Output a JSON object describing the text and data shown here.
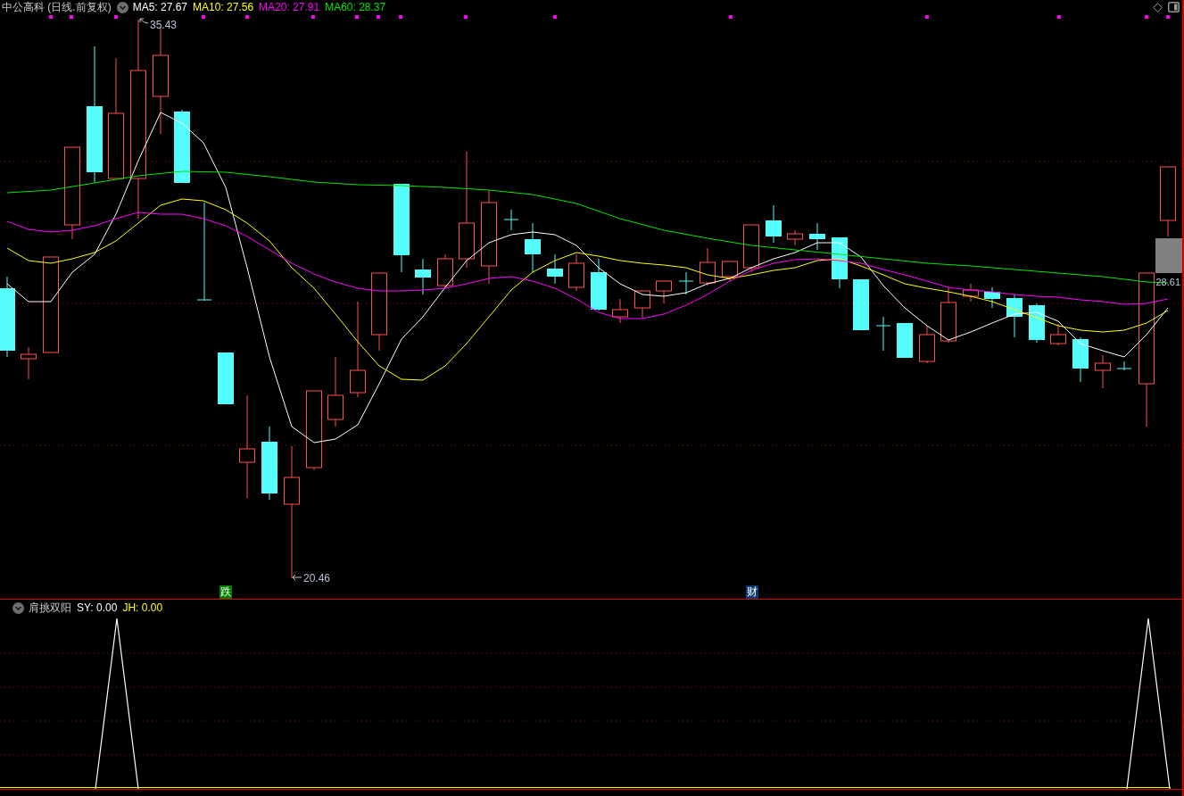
{
  "chart_header": {
    "title": "中公高科 (日线.前复权)",
    "indicators": [
      {
        "label": "MA5: 27.67",
        "color": "#ffffff"
      },
      {
        "label": "MA10: 27.56",
        "color": "#ffff00"
      },
      {
        "label": "MA20: 27.91",
        "color": "#ff00ff"
      },
      {
        "label": "MA60: 28.37",
        "color": "#00e600"
      }
    ]
  },
  "main_chart": {
    "high_label": "35.43",
    "low_label": "20.46",
    "last_price": "28.61",
    "events": [
      {
        "label": "跌",
        "color": "#008000"
      },
      {
        "label": "财",
        "color": "#0a3b6e"
      }
    ]
  },
  "sub_chart": {
    "title": "肩挑双阳",
    "indicators": [
      {
        "label": "SY: 0.00",
        "color": "#ffffff"
      },
      {
        "label": "JH: 0.00",
        "color": "#ffff00"
      }
    ]
  }
}
